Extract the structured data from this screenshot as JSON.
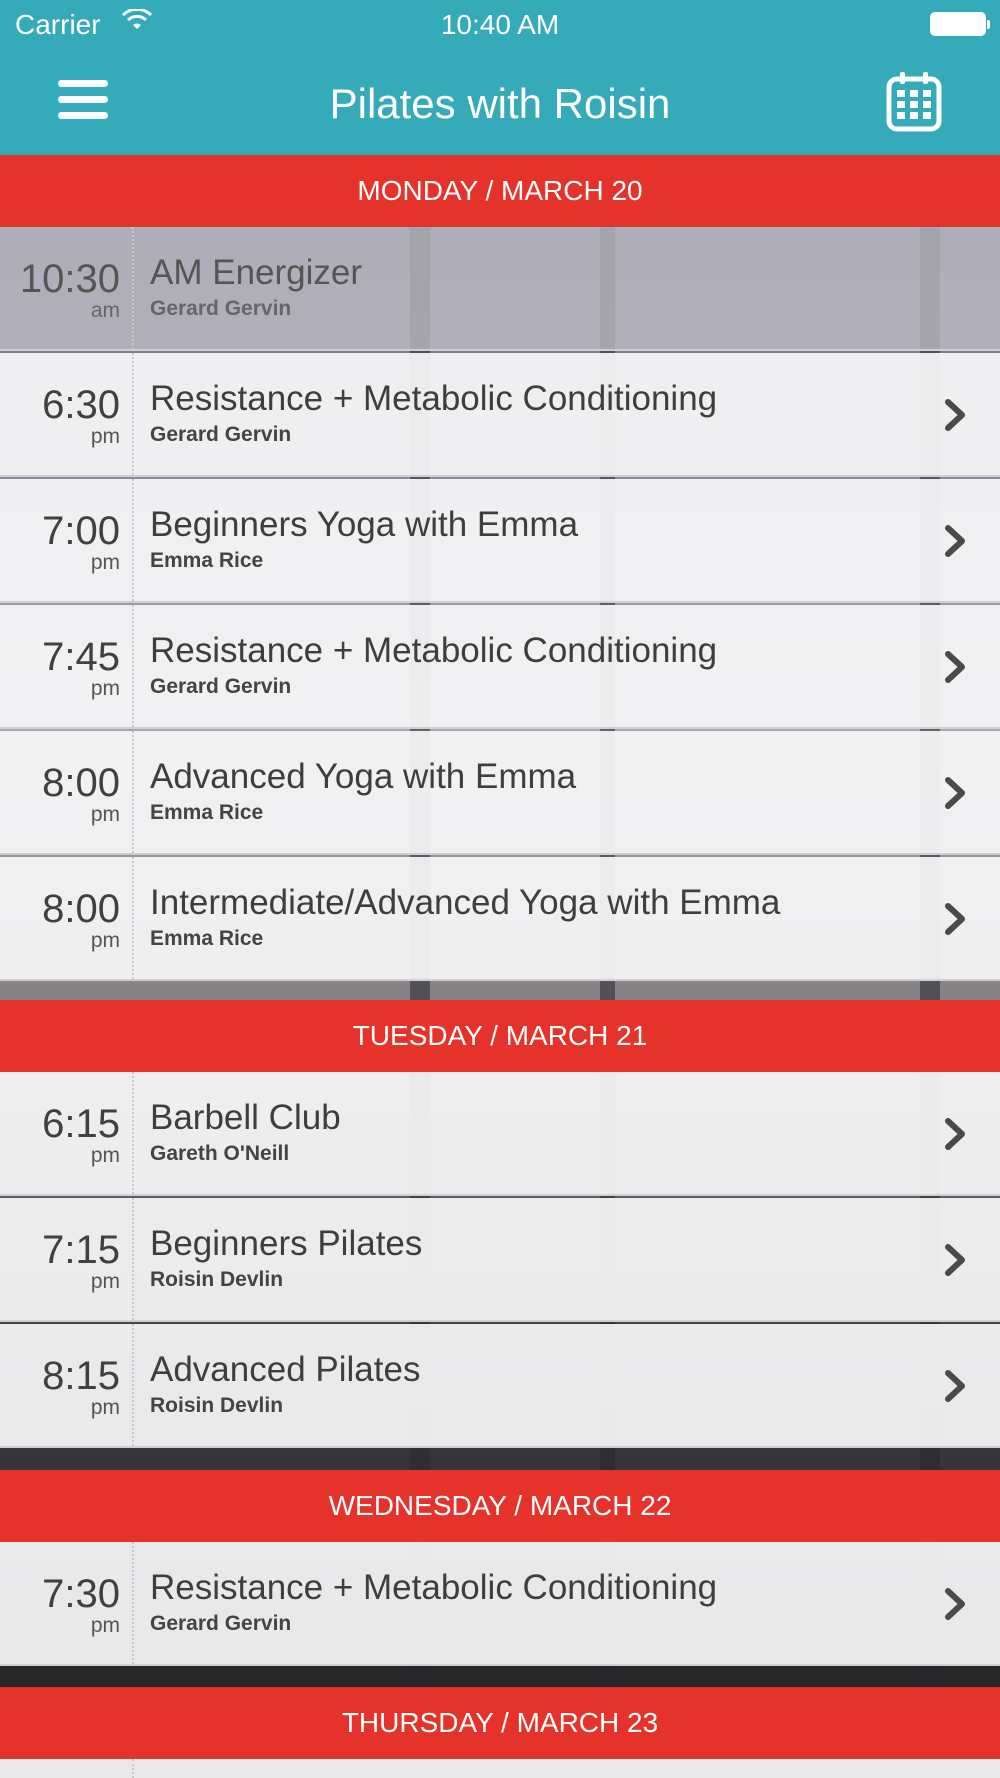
{
  "status_bar": {
    "carrier": "Carrier",
    "time": "10:40 AM"
  },
  "nav": {
    "title": "Pilates with Roisin",
    "menu_icon": "hamburger-menu-icon",
    "calendar_icon": "calendar-icon"
  },
  "colors": {
    "header": "#35aab8",
    "day_header": "#e5322a"
  },
  "days": [
    {
      "label": "MONDAY / MARCH 20",
      "classes": [
        {
          "time": "10:30",
          "ampm": "am",
          "name": "AM Energizer",
          "instructor": "Gerard Gervin"
        },
        {
          "time": "6:30",
          "ampm": "pm",
          "name": "Resistance + Metabolic Conditioning",
          "instructor": "Gerard Gervin"
        },
        {
          "time": "7:00",
          "ampm": "pm",
          "name": "Beginners Yoga with Emma",
          "instructor": "Emma Rice"
        },
        {
          "time": "7:45",
          "ampm": "pm",
          "name": "Resistance + Metabolic Conditioning",
          "instructor": "Gerard Gervin"
        },
        {
          "time": "8:00",
          "ampm": "pm",
          "name": "Advanced Yoga with Emma",
          "instructor": "Emma Rice"
        },
        {
          "time": "8:00",
          "ampm": "pm",
          "name": "Intermediate/Advanced Yoga with Emma",
          "instructor": "Emma Rice"
        }
      ]
    },
    {
      "label": "TUESDAY / MARCH 21",
      "classes": [
        {
          "time": "6:15",
          "ampm": "pm",
          "name": "Barbell Club",
          "instructor": "Gareth O'Neill"
        },
        {
          "time": "7:15",
          "ampm": "pm",
          "name": "Beginners Pilates",
          "instructor": "Roisin Devlin"
        },
        {
          "time": "8:15",
          "ampm": "pm",
          "name": "Advanced Pilates",
          "instructor": "Roisin Devlin"
        }
      ]
    },
    {
      "label": "WEDNESDAY / MARCH 22",
      "classes": [
        {
          "time": "7:30",
          "ampm": "pm",
          "name": "Resistance + Metabolic Conditioning",
          "instructor": "Gerard Gervin"
        }
      ]
    },
    {
      "label": "THURSDAY / MARCH 23",
      "classes": []
    }
  ]
}
